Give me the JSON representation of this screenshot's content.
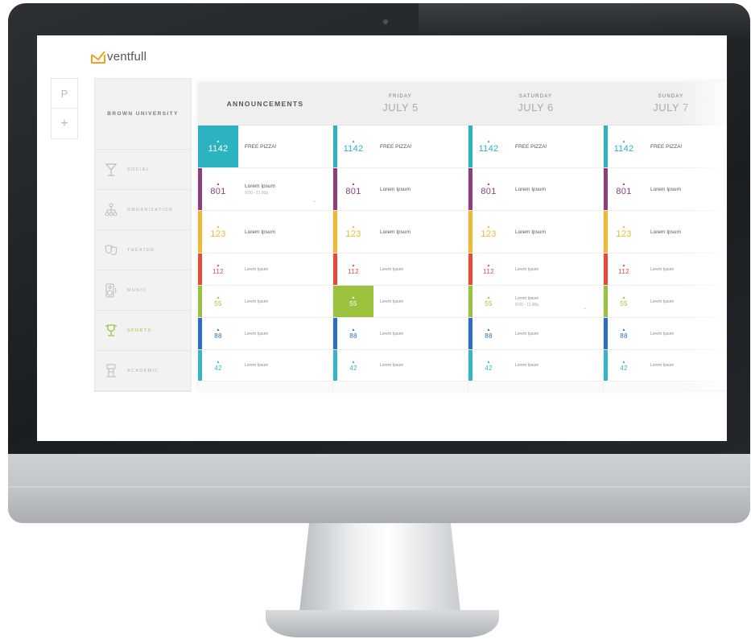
{
  "app": {
    "logo_text": "ventfull",
    "brand_color": "#f2a11f"
  },
  "rail": [
    {
      "label": "P",
      "icon": "profile-icon"
    },
    {
      "label": "+",
      "icon": "plus-icon"
    }
  ],
  "sidebar": {
    "title": "BROWN UNIVERSITY",
    "items": [
      {
        "label": "SOCIAL",
        "icon": "cocktail-icon",
        "active": false
      },
      {
        "label": "ORGANIZATION",
        "icon": "sitemap-icon",
        "active": false
      },
      {
        "label": "THEATER",
        "icon": "theater-masks-icon",
        "active": false
      },
      {
        "label": "MUSIC",
        "icon": "speaker-icon",
        "active": false
      },
      {
        "label": "SPORTS",
        "icon": "trophy-icon",
        "active": true
      },
      {
        "label": "ACADEMIC",
        "icon": "podium-icon",
        "active": false
      }
    ]
  },
  "colors": {
    "teal": "#2bb3c0",
    "purple": "#8d3e7e",
    "yellow": "#f0b830",
    "red": "#e54b3c",
    "green": "#9ac23c",
    "blue": "#2c6fc0",
    "cyan": "#32b6c4"
  },
  "columns": [
    {
      "title": "ANNOUNCEMENTS",
      "rows": [
        {
          "color": "teal",
          "num": "1142",
          "title": "FREE PIZZA!",
          "filled": true
        },
        {
          "color": "purple",
          "num": "801",
          "title": "Lorem Ipsum",
          "time": "9:00 - 11:00p",
          "chevron": "⌄"
        },
        {
          "color": "yellow",
          "num": "123",
          "title": "Lorem Ipsum"
        },
        {
          "color": "red",
          "num": "112",
          "title": "Lorem Ipsum"
        },
        {
          "color": "green",
          "num": "55",
          "title": "Lorem Ipsum"
        },
        {
          "color": "blue",
          "num": "88",
          "title": "Lorem Ipsum"
        },
        {
          "color": "cyan",
          "num": "42",
          "title": "Lorem Ipsum"
        }
      ]
    },
    {
      "day": "FRIDAY",
      "date": "JULY 5",
      "rows": [
        {
          "color": "teal",
          "num": "1142",
          "title": "FREE PIZZA!"
        },
        {
          "color": "purple",
          "num": "801",
          "title": "Lorem Ipsum"
        },
        {
          "color": "yellow",
          "num": "123",
          "title": "Lorem Ipsum"
        },
        {
          "color": "red",
          "num": "112",
          "title": "Lorem Ipsum"
        },
        {
          "color": "green",
          "num": "55",
          "title": "Lorem Ipsum",
          "filled": true
        },
        {
          "color": "blue",
          "num": "88",
          "title": "Lorem Ipsum"
        },
        {
          "color": "cyan",
          "num": "42",
          "title": "Lorem Ipsum"
        }
      ]
    },
    {
      "day": "SATURDAY",
      "date": "JULY 6",
      "rows": [
        {
          "color": "teal",
          "num": "1142",
          "title": "FREE PIZZA!"
        },
        {
          "color": "purple",
          "num": "801",
          "title": "Lorem Ipsum"
        },
        {
          "color": "yellow",
          "num": "123",
          "title": "Lorem Ipsum"
        },
        {
          "color": "red",
          "num": "112",
          "title": "Lorem Ipsum"
        },
        {
          "color": "green",
          "num": "55",
          "title": "Lorem Ipsum",
          "time": "9:00 - 11:00p",
          "chevron": "⌄"
        },
        {
          "color": "blue",
          "num": "88",
          "title": "Lorem Ipsum"
        },
        {
          "color": "cyan",
          "num": "42",
          "title": "Lorem Ipsum"
        }
      ]
    },
    {
      "day": "SUNDAY",
      "date": "JULY 7",
      "rows": [
        {
          "color": "teal",
          "num": "1142",
          "title": "FREE PIZZA!"
        },
        {
          "color": "purple",
          "num": "801",
          "title": "Lorem Ipsum"
        },
        {
          "color": "yellow",
          "num": "123",
          "title": "Lorem Ipsum"
        },
        {
          "color": "red",
          "num": "112",
          "title": "Lorem Ipsum"
        },
        {
          "color": "green",
          "num": "55",
          "title": "Lorem Ipsum"
        },
        {
          "color": "blue",
          "num": "88",
          "title": "Lorem Ipsum"
        },
        {
          "color": "cyan",
          "num": "42",
          "title": "Lorem Ipsum"
        }
      ]
    }
  ]
}
